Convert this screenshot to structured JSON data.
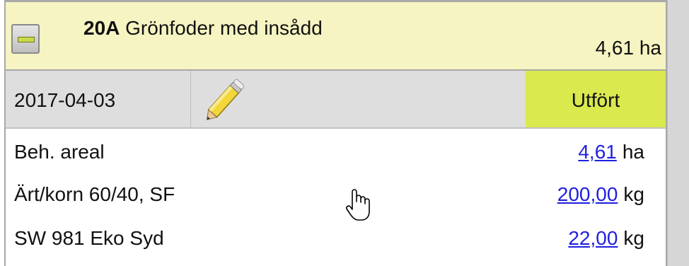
{
  "header": {
    "code": "20A",
    "title": "Grönfoder med insådd",
    "area": "4,61 ha",
    "header_bg": "#f5f4c2"
  },
  "date_row": {
    "date": "2017-04-03",
    "edit_icon": "pencil-icon",
    "status": "Utfört",
    "status_color": "#d9e94e"
  },
  "rows": [
    {
      "label": "Beh. areal",
      "value": "4,61",
      "unit": "ha"
    },
    {
      "label": "Ärt/korn 60/40, SF",
      "value": "200,00",
      "unit": "kg"
    },
    {
      "label": "SW 981 Eko Syd",
      "value": "22,00",
      "unit": "kg"
    }
  ],
  "link_color": "#1f1fe0"
}
